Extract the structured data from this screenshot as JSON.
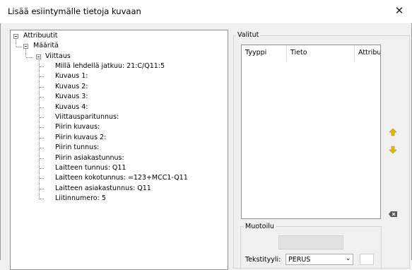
{
  "window": {
    "title": "Lisää esiintymälle tietoja kuvaan",
    "close_glyph": "✕"
  },
  "tree": {
    "root": "Attribuutit",
    "level1": "Määritä",
    "level2": "Viittaus",
    "items": [
      "Millä lehdellä jatkuu: 21:C/Q11:5",
      "Kuvaus 1:",
      "Kuvaus 2:",
      "Kuvaus 3:",
      "Kuvaus 4:",
      "Viittausparitunnus:",
      "Piirin kuvaus:",
      "Piirin kuvaus 2:",
      "Piirin tunnus:",
      "Piirin asiakastunnus:",
      "Laitteen tunnus: Q11",
      "Laitteen kokotunnus: =123+MCC1-Q11",
      "Laitteen asiakastunnus: Q11",
      "Liitinnumero: 5"
    ]
  },
  "selected": {
    "group_label": "Valitut",
    "columns": [
      "Tyyppi",
      "Tieto",
      "Attribuutti"
    ]
  },
  "side_buttons": {
    "up_icon": "arrow-up-icon",
    "down_icon": "arrow-down-icon",
    "delete_icon": "delete-icon"
  },
  "format": {
    "group_label": "Muotoilu",
    "style_label": "Tekstityyli:",
    "style_value": "PERUS"
  },
  "colors": {
    "accent": "#e6b800",
    "window_bg": "#f0f0f0"
  }
}
